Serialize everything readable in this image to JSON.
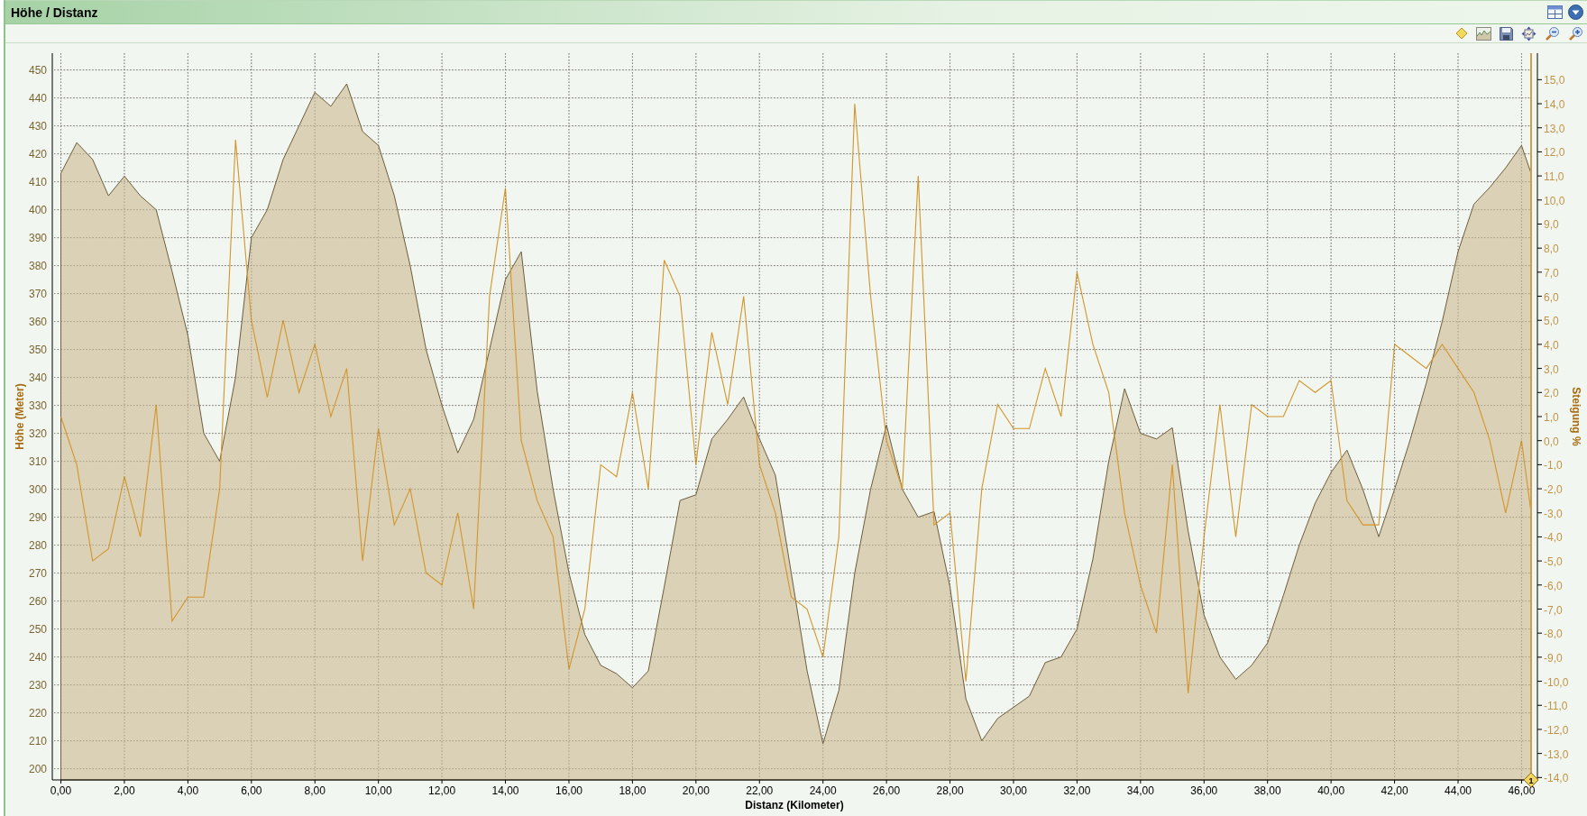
{
  "window": {
    "title": "Höhe / Distanz"
  },
  "chart": {
    "chart_data": {
      "type": "area",
      "xlabel": "Distanz (Kilometer)",
      "ylabel": "Höhe (Meter)",
      "y2label": "Steigung %",
      "grid": true,
      "xlim": [
        -0.1,
        46.3
      ],
      "ylim": [
        196,
        456
      ],
      "y2lim": [
        -14.1,
        16.1
      ],
      "x": [
        0,
        0.5,
        1,
        1.5,
        2,
        2.5,
        3,
        3.5,
        4,
        4.5,
        5,
        5.5,
        6,
        6.5,
        7,
        7.5,
        8,
        8.5,
        9,
        9.5,
        10,
        10.5,
        11,
        11.5,
        12,
        12.5,
        13,
        13.5,
        14,
        14.5,
        15,
        15.5,
        16,
        16.5,
        17,
        17.5,
        18,
        18.5,
        19,
        19.5,
        20,
        20.5,
        21,
        21.5,
        22,
        22.5,
        23,
        23.5,
        24,
        24.5,
        25,
        25.5,
        26,
        26.5,
        27,
        27.5,
        28,
        28.5,
        29,
        29.5,
        30,
        30.5,
        31,
        31.5,
        32,
        32.5,
        33,
        33.5,
        34,
        34.5,
        35,
        35.5,
        36,
        36.5,
        37,
        37.5,
        38,
        38.5,
        39,
        39.5,
        40,
        40.5,
        41,
        41.5,
        42,
        42.5,
        43,
        43.5,
        44,
        44.5,
        45,
        45.5,
        46,
        46.3
      ],
      "series": [
        {
          "type": "area",
          "color": "#d9cfb2",
          "values": [
            413,
            424,
            418,
            405,
            412,
            405,
            400,
            378,
            355,
            320,
            310,
            340,
            390,
            400,
            418,
            430,
            442,
            437,
            445,
            428,
            423,
            405,
            380,
            350,
            330,
            313,
            325,
            350,
            375,
            385,
            335,
            300,
            270,
            248,
            237,
            234,
            229,
            235,
            265,
            296,
            298,
            318,
            325,
            333,
            318,
            305,
            270,
            235,
            209,
            228,
            270,
            300,
            323,
            300,
            290,
            292,
            265,
            225,
            210,
            218,
            222,
            226,
            238,
            240,
            250,
            275,
            310,
            336,
            320,
            318,
            322,
            285,
            255,
            240,
            232,
            237,
            245,
            262,
            280,
            295,
            306,
            314,
            300,
            283,
            300,
            318,
            338,
            360,
            385,
            402,
            408,
            415,
            423,
            413
          ]
        },
        {
          "type": "line",
          "axis": "y2",
          "color": "#d4952a",
          "values": [
            1.0,
            -1.0,
            -5,
            -4.5,
            -1.5,
            -4,
            1.5,
            -7.5,
            -6.5,
            -6.5,
            -2,
            12.5,
            5,
            1.8,
            5,
            2,
            4,
            1,
            3,
            -5,
            0.5,
            -3.5,
            -2,
            -5.5,
            -6,
            -3,
            -7,
            6,
            10.5,
            0,
            -2.5,
            -4,
            -9.5,
            -7,
            -1,
            -1.5,
            2,
            -2,
            7.5,
            6,
            -1,
            4.5,
            1.5,
            6,
            -1,
            -3,
            -6.5,
            -7,
            -9,
            -4,
            14,
            6,
            0,
            -2,
            11,
            -3.5,
            -3,
            -10,
            -2,
            1.5,
            0.5,
            0.5,
            3,
            1,
            7,
            4,
            2,
            -3,
            -6,
            -8,
            -1,
            -10.5,
            -4,
            1.5,
            -4,
            1.5,
            1,
            1,
            2.5,
            2,
            2.5,
            -2.5,
            -3.5,
            -3.5,
            4,
            3.5,
            3,
            4,
            3,
            2,
            0,
            -3,
            0,
            -3
          ]
        }
      ],
      "xticks": [
        {
          "value": 0,
          "label": "0,00"
        },
        {
          "value": 2,
          "label": "2,00"
        },
        {
          "value": 4,
          "label": "4,00"
        },
        {
          "value": 6,
          "label": "6,00"
        },
        {
          "value": 8,
          "label": "8,00"
        },
        {
          "value": 10,
          "label": "10,00"
        },
        {
          "value": 12,
          "label": "12,00"
        },
        {
          "value": 14,
          "label": "14,00"
        },
        {
          "value": 16,
          "label": "16,00"
        },
        {
          "value": 18,
          "label": "18,00"
        },
        {
          "value": 20,
          "label": "20,00"
        },
        {
          "value": 22,
          "label": "22,00"
        },
        {
          "value": 24,
          "label": "24,00"
        },
        {
          "value": 26,
          "label": "26,00"
        },
        {
          "value": 28,
          "label": "28,00"
        },
        {
          "value": 30,
          "label": "30,00"
        },
        {
          "value": 32,
          "label": "32,00"
        },
        {
          "value": 34,
          "label": "34,00"
        },
        {
          "value": 36,
          "label": "36,00"
        },
        {
          "value": 38,
          "label": "38,00"
        },
        {
          "value": 40,
          "label": "40,00"
        },
        {
          "value": 42,
          "label": "42,00"
        },
        {
          "value": 44,
          "label": "44,00"
        },
        {
          "value": 46,
          "label": "46,00"
        }
      ],
      "yticks": [
        200,
        210,
        220,
        230,
        240,
        250,
        260,
        270,
        280,
        290,
        300,
        310,
        320,
        330,
        340,
        350,
        360,
        370,
        380,
        390,
        400,
        410,
        420,
        430,
        440,
        450
      ],
      "y2ticks": [
        {
          "value": -14,
          "label": "-14,0"
        },
        {
          "value": -13,
          "label": "-13,0"
        },
        {
          "value": -12,
          "label": "-12,0"
        },
        {
          "value": -11,
          "label": "-11,0"
        },
        {
          "value": -10,
          "label": "-10,0"
        },
        {
          "value": -9,
          "label": "-9,0"
        },
        {
          "value": -8,
          "label": "-8,0"
        },
        {
          "value": -7,
          "label": "-7,0"
        },
        {
          "value": -6,
          "label": "-6,0"
        },
        {
          "value": -5,
          "label": "-5,0"
        },
        {
          "value": -4,
          "label": "-4,0"
        },
        {
          "value": -3,
          "label": "-3,0"
        },
        {
          "value": -2,
          "label": "-2,0"
        },
        {
          "value": -1,
          "label": "-1,0"
        },
        {
          "value": 0,
          "label": "0,0"
        },
        {
          "value": 1,
          "label": "1,0"
        },
        {
          "value": 2,
          "label": "2,0"
        },
        {
          "value": 3,
          "label": "3,0"
        },
        {
          "value": 4,
          "label": "4,0"
        },
        {
          "value": 5,
          "label": "5,0"
        },
        {
          "value": 6,
          "label": "6,0"
        },
        {
          "value": 7,
          "label": "7,0"
        },
        {
          "value": 8,
          "label": "8,0"
        },
        {
          "value": 9,
          "label": "9,0"
        },
        {
          "value": 10,
          "label": "10,0"
        },
        {
          "value": 11,
          "label": "11,0"
        },
        {
          "value": 12,
          "label": "12,0"
        },
        {
          "value": 13,
          "label": "13,0"
        },
        {
          "value": 14,
          "label": "14,0"
        },
        {
          "value": 15,
          "label": "15,0"
        }
      ],
      "annotations": [
        {
          "x": 46.3,
          "text": "1"
        }
      ]
    }
  }
}
